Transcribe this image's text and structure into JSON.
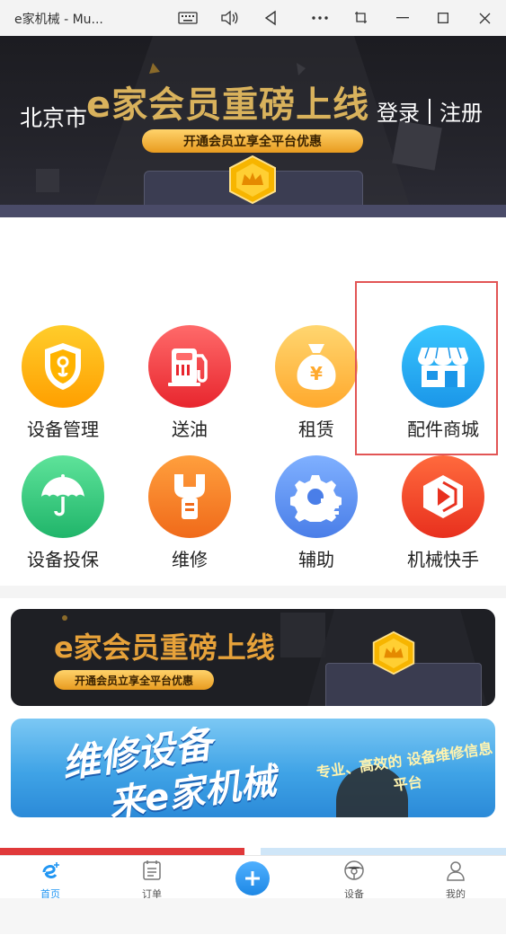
{
  "window": {
    "title": "e家机械 - Mu...",
    "controls": [
      "keyboard-icon",
      "volume-icon",
      "back-icon",
      "more-icon",
      "screenshot-icon",
      "minimize-icon",
      "maximize-icon",
      "close-icon"
    ]
  },
  "hero": {
    "city": "北京市",
    "login": "登录",
    "register": "注册",
    "headline": "e家会员重磅上线",
    "pill": "开通会员立享全平台优惠"
  },
  "services": [
    {
      "label": "设备管理",
      "icon": "equipment-shield-icon",
      "color": "#ffb300"
    },
    {
      "label": "送油",
      "icon": "fuel-pump-icon",
      "color": "#f2444b"
    },
    {
      "label": "租赁",
      "icon": "money-bag-icon",
      "color": "#ffb54a"
    },
    {
      "label": "配件商城",
      "icon": "store-icon",
      "color": "#27aaf0"
    },
    {
      "label": "设备投保",
      "icon": "umbrella-icon",
      "color": "#2ec27e"
    },
    {
      "label": "维修",
      "icon": "wrench-icon",
      "color": "#f58a2b"
    },
    {
      "label": "辅助",
      "icon": "gear-list-icon",
      "color": "#5b8ff0"
    },
    {
      "label": "机械快手",
      "icon": "play-icon",
      "color": "#f2452b"
    }
  ],
  "banners": {
    "membership_title": "e家会员重磅上线",
    "membership_pill": "开通会员立享全平台优惠",
    "repair_line1": "维修设备",
    "repair_line2": "来e家机械",
    "repair_sub": "专业、高效的 设备维修信息平台"
  },
  "nav": [
    {
      "label": "首页",
      "icon": "home-e-icon",
      "active": true
    },
    {
      "label": "订单",
      "icon": "order-list-icon",
      "active": false
    },
    {
      "label": "",
      "icon": "plus-icon",
      "active": false
    },
    {
      "label": "设备",
      "icon": "steering-wheel-icon",
      "active": false
    },
    {
      "label": "我的",
      "icon": "user-icon",
      "active": false
    }
  ],
  "colors": {
    "accent": "#2196f3",
    "highlight_border": "#e25555",
    "gold": "#d9b25c"
  }
}
